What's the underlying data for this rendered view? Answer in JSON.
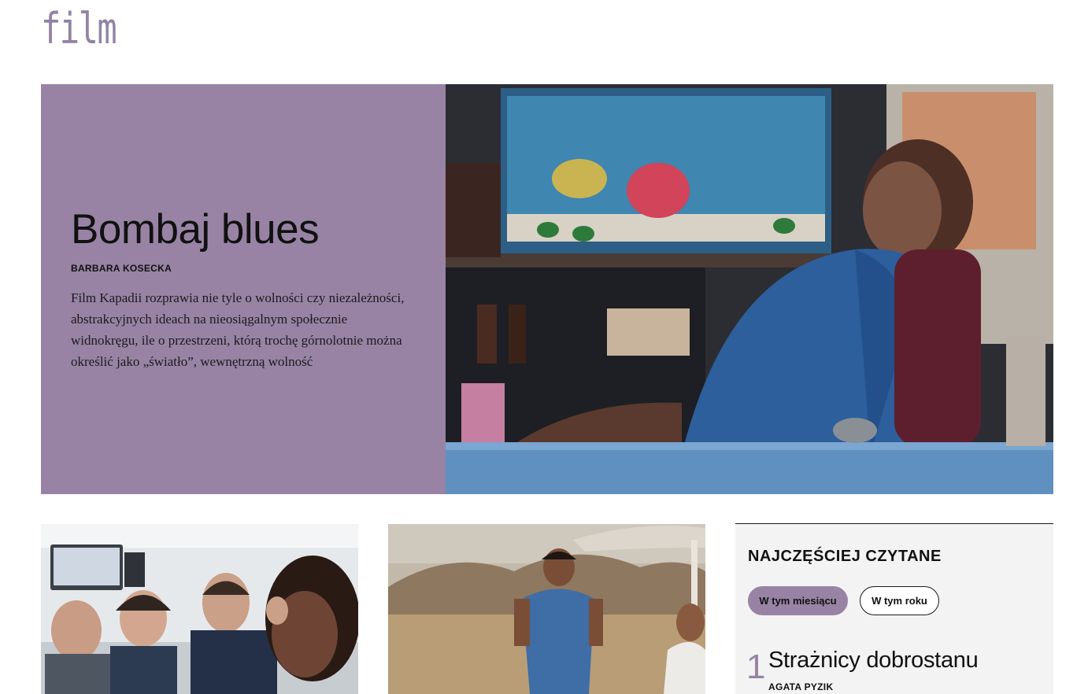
{
  "site": {
    "logo_text": "film"
  },
  "hero": {
    "title": "Bombaj blues",
    "author": "BARBARA KOSECKA",
    "lead": "Film Kapadii rozprawia nie tyle o wolności czy niezależności, abstrakcyjnych ideach na nieosiągalnym społecznie widnokręgu, ile o przestrzeni, którą trochę górnolotnie można określić jako „światło”, wewnętrzną wolność"
  },
  "most_read": {
    "heading": "NAJCZĘŚCIEJ CZYTANE",
    "tabs": [
      {
        "label": "W tym miesiącu",
        "active": true
      },
      {
        "label": "W tym roku",
        "active": false
      }
    ],
    "items": [
      {
        "rank": "1",
        "title": "Strażnicy dobrostanu",
        "author": "AGATA PYZIK"
      }
    ]
  },
  "colors": {
    "accent": "#9883a5",
    "logo": "#9283a5",
    "panel_bg": "#f3f3f3"
  }
}
